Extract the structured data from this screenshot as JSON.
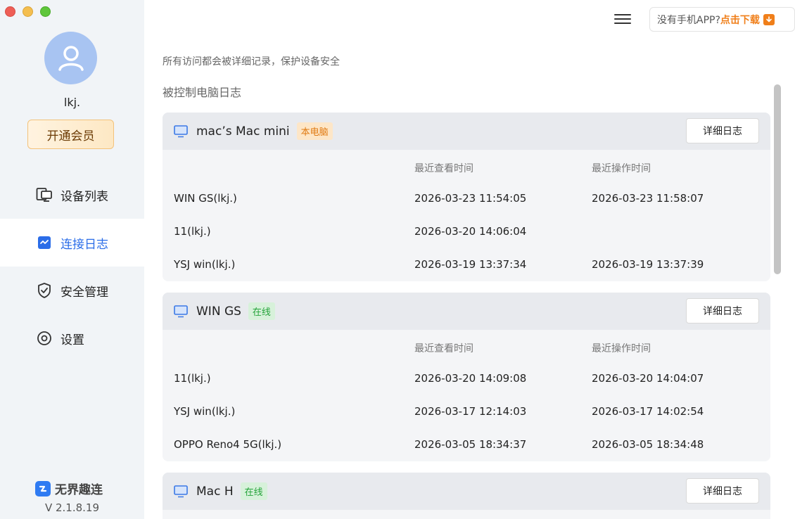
{
  "sidebar": {
    "username": "lkj.",
    "vip_label": "开通会员",
    "nav": [
      {
        "label": "设备列表",
        "icon": "device-list-icon",
        "active": false
      },
      {
        "label": "连接日志",
        "icon": "connection-log-icon",
        "active": true
      },
      {
        "label": "安全管理",
        "icon": "shield-icon",
        "active": false
      },
      {
        "label": "设置",
        "icon": "settings-icon",
        "active": false
      }
    ],
    "brand": "无界趣连",
    "version": "V 2.1.8.19"
  },
  "header": {
    "download_question": "没有手机APP?",
    "download_link": "点击下载"
  },
  "notice": "所有访问都会被详细记录，保护设备安全",
  "section_title": "被控制电脑日志",
  "columns": {
    "last_view": "最近查看时间",
    "last_operation": "最近操作时间"
  },
  "detail_button_label": "详细日志",
  "cards": [
    {
      "name": "mac’s Mac mini",
      "badge": "本电脑",
      "badge_type": "local",
      "rows": [
        {
          "client": "WIN GS(lkj.)",
          "last_view": "2026-03-23 11:54:05",
          "last_operation": "2026-03-23 11:58:07"
        },
        {
          "client": "11(lkj.)",
          "last_view": "2026-03-20 14:06:04",
          "last_operation": ""
        },
        {
          "client": "YSJ win(lkj.)",
          "last_view": "2026-03-19 13:37:34",
          "last_operation": "2026-03-19 13:37:39"
        }
      ]
    },
    {
      "name": "WIN GS",
      "badge": "在线",
      "badge_type": "online",
      "rows": [
        {
          "client": "11(lkj.)",
          "last_view": "2026-03-20 14:09:08",
          "last_operation": "2026-03-20 14:04:07"
        },
        {
          "client": "YSJ win(lkj.)",
          "last_view": "2026-03-17 12:14:03",
          "last_operation": "2026-03-17 14:02:54"
        },
        {
          "client": "OPPO Reno4 5G(lkj.)",
          "last_view": "2026-03-05 18:34:37",
          "last_operation": "2026-03-05 18:34:48"
        }
      ]
    },
    {
      "name": "Mac H",
      "badge": "在线",
      "badge_type": "online",
      "rows": []
    }
  ],
  "colors": {
    "accent": "#2b6de8",
    "local_badge": "#e07a12",
    "online_badge": "#24a33a",
    "download_link": "#f07f1a"
  }
}
